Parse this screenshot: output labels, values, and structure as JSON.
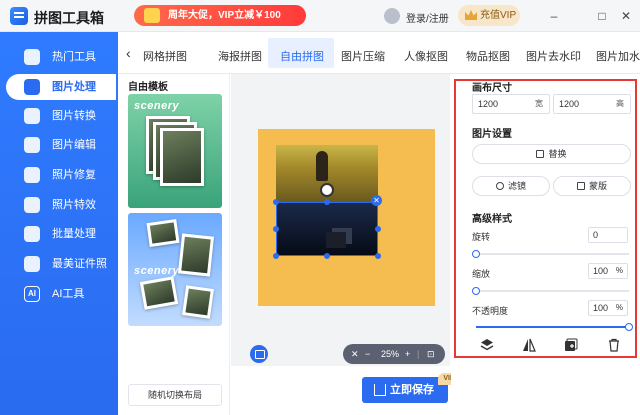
{
  "app": {
    "title": "拼图工具箱"
  },
  "header": {
    "promo": "周年大促，VIP立减￥100",
    "login": "登录/注册",
    "vip": "充值VIP",
    "min_glyph": "–",
    "max_glyph": "□",
    "close_glyph": "✕"
  },
  "sidebar": {
    "items": [
      {
        "label": "热门工具"
      },
      {
        "label": "图片处理"
      },
      {
        "label": "图片转换"
      },
      {
        "label": "图片编辑"
      },
      {
        "label": "照片修复"
      },
      {
        "label": "照片特效"
      },
      {
        "label": "批量处理"
      },
      {
        "label": "最美证件照"
      },
      {
        "label": "AI工具"
      }
    ],
    "ai_icon_text": "AI"
  },
  "tabs": {
    "back": "‹",
    "items": [
      {
        "label": "网格拼图"
      },
      {
        "label": "海报拼图"
      },
      {
        "label": "自由拼图"
      },
      {
        "label": "图片压缩"
      },
      {
        "label": "人像抠图"
      },
      {
        "label": "物品抠图"
      },
      {
        "label": "图片去水印"
      },
      {
        "label": "图片加水"
      }
    ]
  },
  "templates": {
    "title": "自由模板",
    "card_word": "scenery",
    "shuffle": "随机切换布局"
  },
  "canvas": {
    "zoom_minus": "−",
    "zoom": "25%",
    "zoom_plus": "+",
    "close_handle": "✕"
  },
  "save": {
    "label": "立即保存",
    "vip_tag": "VIP"
  },
  "panel": {
    "canvas_size": {
      "title": "画布尺寸",
      "width": "1200",
      "width_unit": "宽",
      "height": "1200",
      "height_unit": "高"
    },
    "image_settings": {
      "title": "图片设置",
      "replace": "替换",
      "filter": "滤镜",
      "mask": "蒙版"
    },
    "advanced": {
      "title": "高级样式",
      "rotate_label": "旋转",
      "rotate_value": "0",
      "rotate_level": 0,
      "scale_label": "缩放",
      "scale_value": "100",
      "scale_level": 0,
      "opacity_label": "不透明度",
      "opacity_value": "100",
      "opacity_level": 1,
      "percent": "%"
    }
  },
  "colors": {
    "accent": "#2a6bf0",
    "poster_bg": "#f5bd4f",
    "highlight": "#e53935"
  }
}
